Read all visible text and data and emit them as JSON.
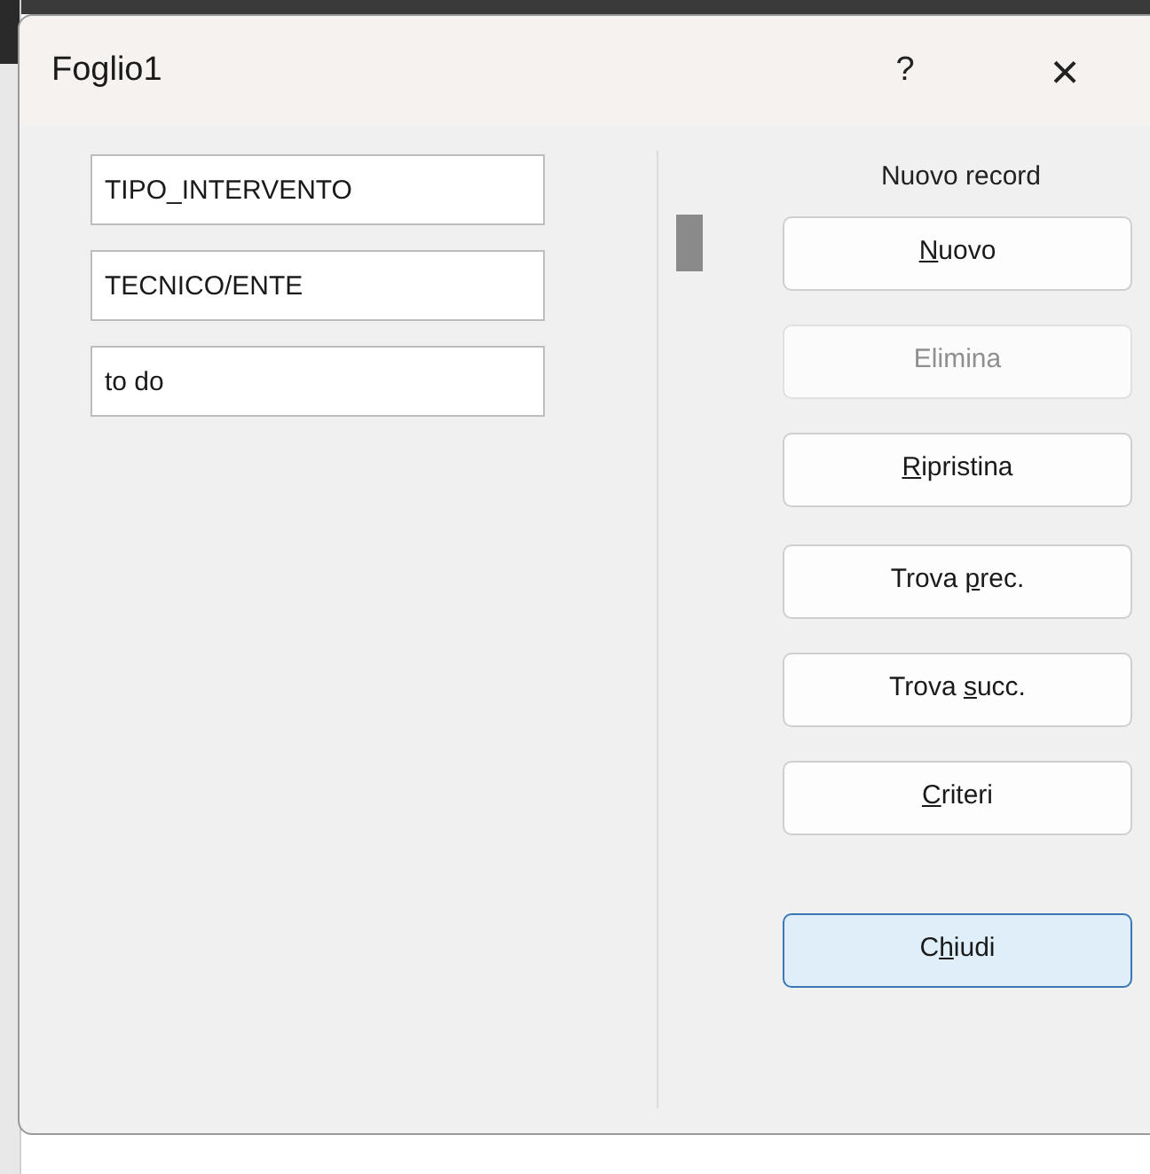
{
  "window": {
    "title": "Foglio1",
    "help": "?",
    "close": "×"
  },
  "fields": [
    {
      "value": "TIPO_INTERVENTO"
    },
    {
      "value": "TECNICO/ENTE"
    },
    {
      "value": "to do"
    }
  ],
  "record_status": "Nuovo record",
  "button_groups": [
    [
      {
        "key": "N",
        "after": "uovo",
        "disabled": false,
        "default": false
      },
      {
        "before": "Elimina",
        "disabled": true,
        "default": false
      },
      {
        "key": "R",
        "after": "ipristina",
        "disabled": false,
        "default": false
      }
    ],
    [
      {
        "before": "Trova ",
        "key": "p",
        "after": "rec.",
        "disabled": false,
        "default": false
      },
      {
        "before": "Trova ",
        "key": "s",
        "after": "ucc.",
        "disabled": false,
        "default": false
      },
      {
        "key": "C",
        "after": "riteri",
        "disabled": false,
        "default": false
      }
    ],
    [
      {
        "before": "C",
        "key": "h",
        "after": "iudi",
        "disabled": false,
        "default": true
      }
    ]
  ]
}
